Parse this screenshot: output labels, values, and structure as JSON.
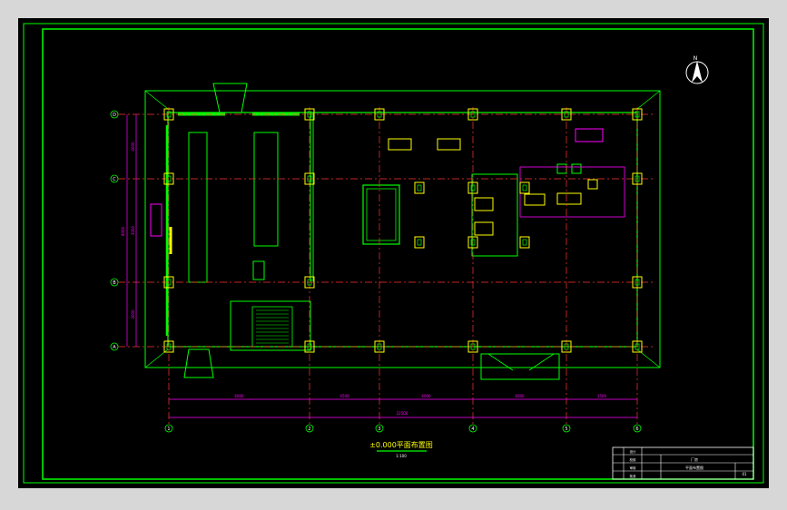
{
  "drawing": {
    "title_text": "±0.000平面布置图",
    "scale_text": "1:100",
    "north_letter": "N",
    "dimension_total": "22500",
    "dimension_segments": [
      "6000",
      "4500",
      "6000",
      "6000",
      "1500"
    ],
    "row_axes": [
      "D",
      "C",
      "B",
      "A"
    ],
    "col_axes": [
      "1",
      "2",
      "3",
      "4",
      "5",
      "6"
    ],
    "left_dims": [
      "4000",
      "3000",
      "3000"
    ],
    "left_dim_total": "9000"
  },
  "title_block": {
    "col_labels": [
      "设计",
      "校核",
      "审核",
      "批准"
    ],
    "drawing_name": "平面布置图",
    "project": "厂房",
    "sheet": "01"
  },
  "colors": {
    "frame": "#00ff00",
    "wall": "#00ff00",
    "axis": "#ff3333",
    "dimension": "#ff00ff",
    "column": "#ffff00",
    "text": "#ffffff"
  }
}
